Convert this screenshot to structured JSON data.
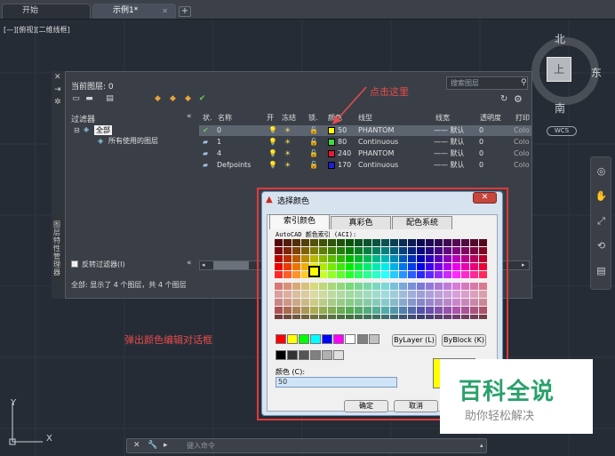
{
  "tabs": [
    {
      "label": "开始"
    },
    {
      "label": "示例1*",
      "close": "✕"
    }
  ],
  "tab_add": "+",
  "view_label": "[—][俯视][二维线框]",
  "viewcube": {
    "north": "北",
    "east": "东",
    "south": "南",
    "top": "上",
    "wcs": "WCS"
  },
  "layer_panel": {
    "current_layer": "当前图层: 0",
    "search_placeholder": "搜索图层",
    "filter_header": "过滤器",
    "filter_tree": [
      "全部",
      "所有使用的图层"
    ],
    "columns": [
      "状.",
      "名称",
      "开",
      "冻结",
      "锁.",
      "颜色",
      "线型",
      "线宽",
      "透明度",
      "打印"
    ],
    "rows": [
      {
        "status": "✔",
        "name": "0",
        "color_name": "50",
        "color": "#ffff00",
        "linetype": "PHANTOM",
        "lineweight": "—— 默认",
        "transparency": "0",
        "plot": "Colo"
      },
      {
        "status": "▰",
        "name": "1",
        "color_name": "80",
        "color": "#3fdc3f",
        "linetype": "Continuous",
        "lineweight": "—— 默认",
        "transparency": "0",
        "plot": "Colo"
      },
      {
        "status": "▰",
        "name": "4",
        "color_name": "240",
        "color": "#e8193e",
        "linetype": "PHANTOM",
        "lineweight": "—— 默认",
        "transparency": "0",
        "plot": "Colo"
      },
      {
        "status": "▰",
        "name": "Defpoints",
        "color_name": "170",
        "color": "#1f1fd0",
        "linetype": "Continuous",
        "lineweight": "—— 默认",
        "transparency": "0",
        "plot": "Colo"
      }
    ],
    "invert_filter": "反转过滤器(I)",
    "status_text": "全部: 显示了 4 个图层，共 4 个图层",
    "side_title": "图层特性管理器"
  },
  "annotations": {
    "click_here": "点击这里",
    "popup": "弹出颜色编辑对话框"
  },
  "dialog": {
    "title": "选择颜色",
    "close": "✕",
    "tabs": [
      "索引颜色",
      "真彩色",
      "配色系统"
    ],
    "aci_label": "AutoCAD 颜色索引 (ACI):",
    "bylayer": "ByLayer (L)",
    "byblock": "ByBlock (K)",
    "color_label": "颜色 (C):",
    "color_value": "50",
    "ok": "确定",
    "cancel": "取消"
  },
  "watermark": {
    "line1": "百科全说",
    "line2": "助你轻松解决"
  },
  "command_line": {
    "placeholder": "键入命令"
  },
  "ucs": {
    "x": "X",
    "y": "Y"
  },
  "colors": {
    "annotation": "#e84b4b",
    "selected_color": "#ffff00",
    "watermark_green": "#2aa16b"
  }
}
